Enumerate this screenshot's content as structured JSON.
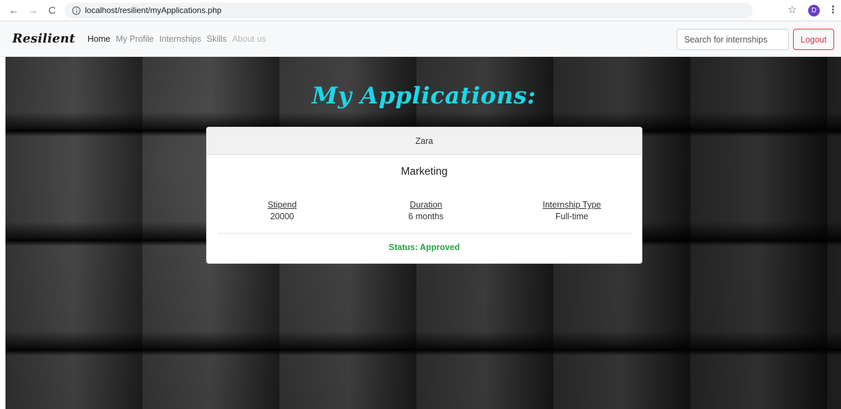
{
  "browser": {
    "url": "localhost/resilient/myApplications.php",
    "avatar_letter": "D"
  },
  "navbar": {
    "brand": "Resilient",
    "links": [
      "Home",
      "My Profile",
      "Internships",
      "Skills",
      "About us"
    ],
    "search_placeholder": "Search for internships",
    "logout_label": "Logout"
  },
  "page": {
    "title": "My Applications:"
  },
  "application": {
    "company": "Zara",
    "role": "Marketing",
    "stipend_label": "Stipend",
    "stipend_value": "20000",
    "duration_label": "Duration",
    "duration_value": "6 months",
    "type_label": "Internship Type",
    "type_value": "Full-time",
    "status": "Status: Approved"
  },
  "colors": {
    "title": "#1ad8e8",
    "status": "#28a745",
    "logout": "#dc3545"
  }
}
